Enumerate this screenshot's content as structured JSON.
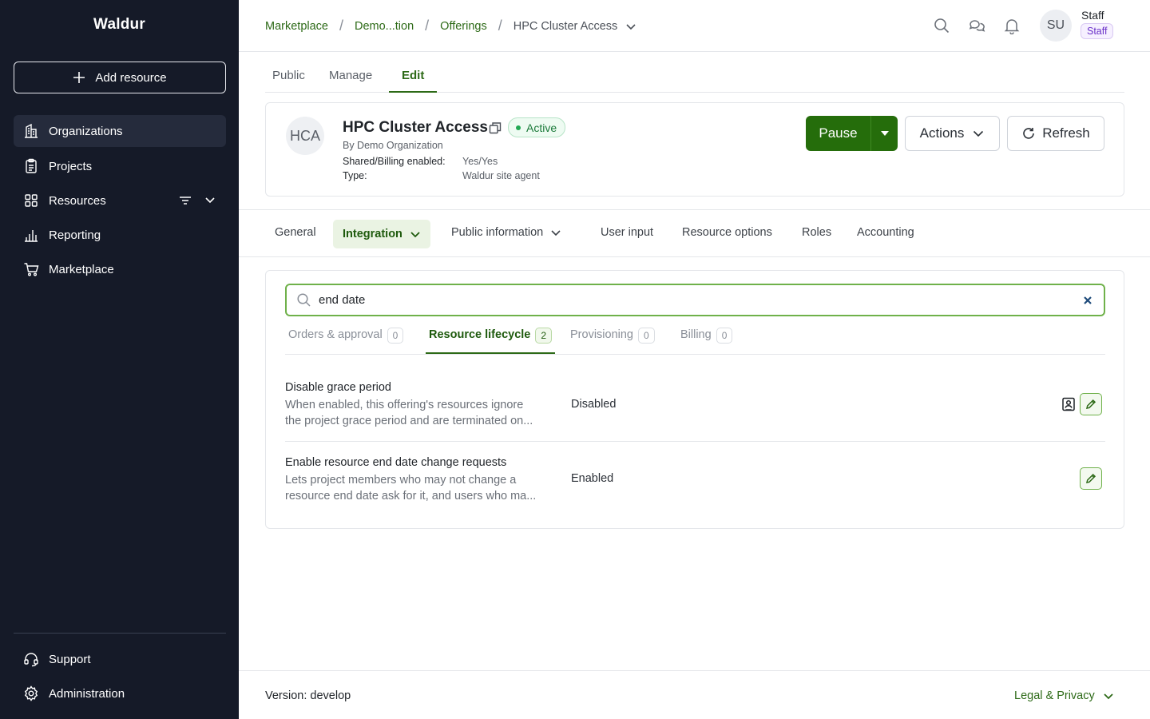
{
  "sidebar": {
    "brand": "Waldur",
    "add_resource_label": "Add resource",
    "items": [
      {
        "label": "Organizations",
        "icon": "building-icon",
        "active": true
      },
      {
        "label": "Projects",
        "icon": "clipboard-icon"
      },
      {
        "label": "Resources",
        "icon": "grid-icon"
      },
      {
        "label": "Reporting",
        "icon": "bar-chart-icon"
      },
      {
        "label": "Marketplace",
        "icon": "cart-icon"
      }
    ],
    "bottom_items": [
      {
        "label": "Support",
        "icon": "headset-icon"
      },
      {
        "label": "Administration",
        "icon": "gear-icon"
      }
    ]
  },
  "header": {
    "breadcrumbs": [
      "Marketplace",
      "Demo...tion",
      "Offerings"
    ],
    "current": "HPC Cluster Access",
    "user": {
      "initials": "SU",
      "name": "Staff",
      "role_badge": "Staff"
    }
  },
  "main_tabs": {
    "items": [
      "Public",
      "Manage",
      "Edit"
    ],
    "active": "Edit"
  },
  "offering": {
    "logo_text": "HCA",
    "title": "HPC Cluster Access",
    "status": "Active",
    "by": "By Demo Organization",
    "shared_billing_key": "Shared/Billing enabled:",
    "shared_billing_value": "Yes/Yes",
    "type_key": "Type:",
    "type_value": "Waldur site agent",
    "pause_label": "Pause",
    "actions_label": "Actions",
    "refresh_label": "Refresh"
  },
  "section_tabs": {
    "items": [
      "General",
      "Integration",
      "Public information",
      "User input",
      "Resource options",
      "Roles",
      "Accounting"
    ],
    "active": "Integration"
  },
  "search": {
    "value": "end date",
    "placeholder": "Search"
  },
  "sub_tabs": [
    {
      "label": "Orders & approval",
      "count": "0"
    },
    {
      "label": "Resource lifecycle",
      "count": "2",
      "active": true
    },
    {
      "label": "Provisioning",
      "count": "0"
    },
    {
      "label": "Billing",
      "count": "0"
    }
  ],
  "settings": [
    {
      "title": "Disable grace period",
      "desc_line1": "When enabled, this offering's resources ignore",
      "desc_line2": "the project grace period and are terminated on...",
      "value": "Disabled"
    },
    {
      "title": "Enable resource end date change requests",
      "desc_line1": "Lets project members who may not change a",
      "desc_line2": "resource end date ask for it, and users who ma...",
      "value": "Enabled"
    }
  ],
  "footer": {
    "version": "Version: develop",
    "legal": "Legal & Privacy"
  },
  "colors": {
    "accent": "#256d0b",
    "sidebar_bg": "#151a28",
    "active_status": "#22a853"
  }
}
